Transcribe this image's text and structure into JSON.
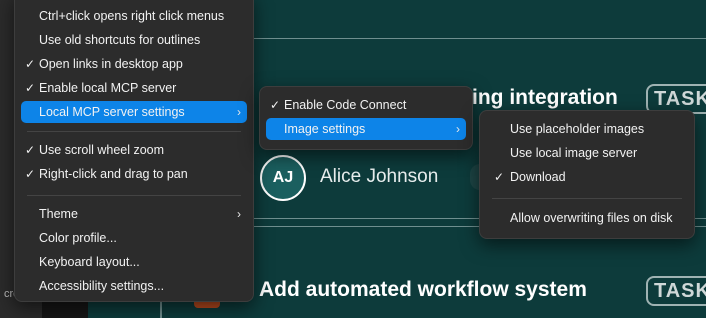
{
  "main_menu": {
    "items": [
      {
        "label": "Ctrl+click opens right click menus",
        "checked": false
      },
      {
        "label": "Use old shortcuts for outlines",
        "checked": false
      },
      {
        "label": "Open links in desktop app",
        "checked": true
      },
      {
        "label": "Enable local MCP server",
        "checked": true
      },
      {
        "label": "Local MCP server settings",
        "checked": false,
        "submenu": true,
        "active": true
      },
      {
        "label": "Use scroll wheel zoom",
        "checked": true
      },
      {
        "label": "Right-click and drag to pan",
        "checked": true
      },
      {
        "label": "Theme",
        "checked": false,
        "submenu": true
      },
      {
        "label": "Color profile...",
        "checked": false
      },
      {
        "label": "Keyboard layout...",
        "checked": false
      },
      {
        "label": "Accessibility settings...",
        "checked": false
      }
    ]
  },
  "mcp_submenu": {
    "items": [
      {
        "label": "Enable Code Connect",
        "checked": true
      },
      {
        "label": "Image settings",
        "checked": false,
        "submenu": true,
        "active": true
      }
    ]
  },
  "image_submenu": {
    "items": [
      {
        "label": "Use placeholder images",
        "checked": false
      },
      {
        "label": "Use local image server",
        "checked": false
      },
      {
        "label": "Download",
        "checked": true
      },
      {
        "label": "Allow overwriting files on disk",
        "checked": false
      }
    ]
  },
  "glyphs": {
    "check": "✓",
    "chevron": "›"
  },
  "canvas": {
    "card1_title": "ing integration",
    "card1_badge": "TASK",
    "avatar_initials": "AJ",
    "person_name": "Alice Johnson",
    "card2_title": "Add automated workflow system",
    "card2_badge": "TASK",
    "left_cut_text": "cre"
  },
  "colors": {
    "accent": "#0d84e8",
    "canvas_bg": "#0d3b3b",
    "menu_bg": "#2c2c2c"
  }
}
